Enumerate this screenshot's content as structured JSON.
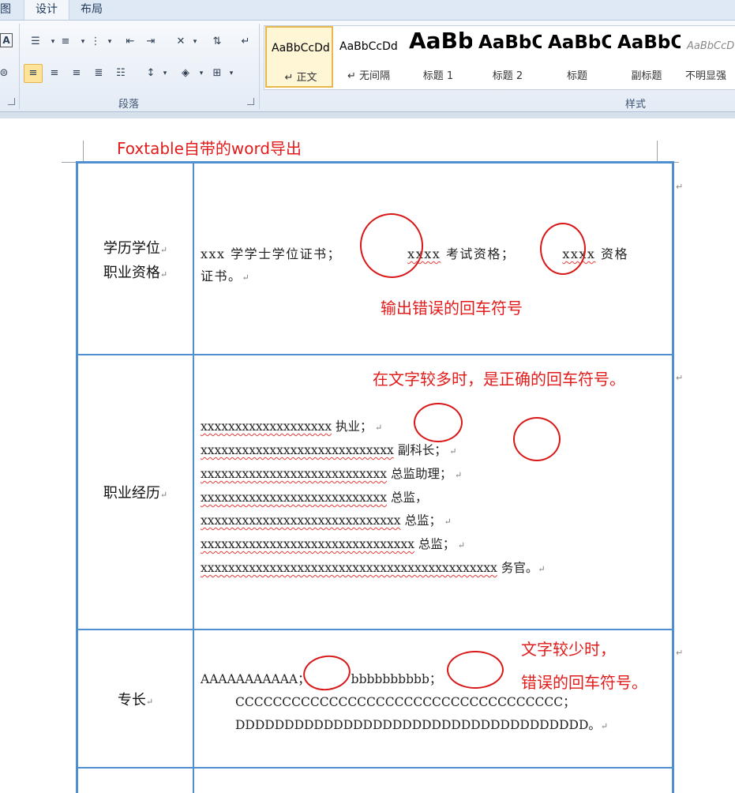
{
  "ribbon": {
    "tabs": [
      "图",
      "设计",
      "布局"
    ],
    "group_paragraph": "段落",
    "group_styles": "样式",
    "styles": [
      {
        "sample": "AaBbCcDd",
        "name": "↵ 正文"
      },
      {
        "sample": "AaBbCcDd",
        "name": "↵ 无间隔"
      },
      {
        "sample": "AaBb",
        "name": "标题 1"
      },
      {
        "sample": "AaBbC",
        "name": "标题 2"
      },
      {
        "sample": "AaBbC",
        "name": "标题"
      },
      {
        "sample": "AaBbC",
        "name": "副标题"
      },
      {
        "sample": "AaBbCcD",
        "name": "不明显强"
      }
    ],
    "icons": [
      "border-a-icon",
      "bullets-icon",
      "numbering-icon",
      "multilevel-list-icon",
      "decrease-indent-icon",
      "increase-indent-icon",
      "chinese-layout-icon",
      "sort-icon",
      "show-marks-icon",
      "align-left-icon",
      "align-center-icon",
      "align-right-icon",
      "justify-icon",
      "distributed-icon",
      "line-spacing-icon",
      "shading-icon",
      "borders-icon"
    ]
  },
  "doc": {
    "label": "Foxtable自带的word导出",
    "rows": [
      {
        "header_lines": [
          "学历学位",
          "职业资格"
        ],
        "line1": [
          "xxx 学学士学位证书；",
          "xxxx",
          " 考试资格；",
          "xxxx",
          " 资格"
        ],
        "line2": "证书。",
        "note": "输出错误的回车符号"
      },
      {
        "header": "职业经历",
        "note": "在文字较多时，是正确的回车符号。",
        "lines": [
          {
            "x": "xxxxxxxxxxxxxxxxxxx",
            "t": " 执业；"
          },
          {
            "x": "xxxxxxxxxxxxxxxxxxxxxxxxxxxx",
            "t": " 副科长；"
          },
          {
            "x": "xxxxxxxxxxxxxxxxxxxxxxxxxxx",
            "t": " 总监助理；"
          },
          {
            "x": "xxxxxxxxxxxxxxxxxxxxxxxxxxx",
            "t": " 总监，"
          },
          {
            "x": "xxxxxxxxxxxxxxxxxxxxxxxxxxxxx",
            "t": " 总监；"
          },
          {
            "x": "xxxxxxxxxxxxxxxxxxxxxxxxxxxxxxx",
            "t": " 总监；"
          },
          {
            "x": "xxxxxxxxxxxxxxxxxxxxxxxxxxxxxxxxxxxxxxxxxxx",
            "t": " 务官。"
          }
        ]
      },
      {
        "header": "专长",
        "note1": "文字较少时，",
        "note2": "错误的回车符号。",
        "line1a": "AAAAAAAAAAA；",
        "line1b": "bbbbbbbbbb；",
        "line2": "CCCCCCCCCCCCCCCCCCCCCCCCCCCCCCCCCCC；",
        "line3": "DDDDDDDDDDDDDDDDDDDDDDDDDDDDDDDDDDDD。"
      }
    ]
  },
  "colors": {
    "table_border": "#4f8ecf",
    "annotation": "#e21b1b",
    "highlight": "#fde49a"
  }
}
